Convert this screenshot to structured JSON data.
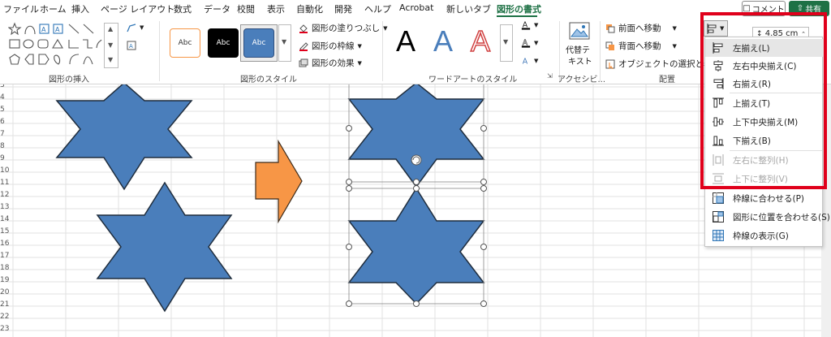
{
  "tabs": [
    "ファイル",
    "ホーム",
    "挿入",
    "ページ レイアウト",
    "数式",
    "データ",
    "校閲",
    "表示",
    "自動化",
    "開発",
    "ヘルプ",
    "Acrobat",
    "新しいタブ",
    "図形の書式"
  ],
  "active_tab": "図形の書式",
  "header_buttons": {
    "comment": "コメント",
    "share": "共有"
  },
  "ribbon": {
    "groups": {
      "insert_shapes": "図形の挿入",
      "shape_styles": "図形のスタイル",
      "wordart_styles": "ワードアートのスタイル",
      "accessibility": "アクセシビ...",
      "arrange": "配置"
    },
    "style_samples": [
      "Abc",
      "Abc",
      "Abc"
    ],
    "shape_fill": "図形の塗りつぶし",
    "shape_outline": "図形の枠線",
    "shape_effects": "図形の効果",
    "wordart_letters": [
      "A",
      "A",
      "A"
    ],
    "alt_text_line1": "代替テ",
    "alt_text_line2": "キスト",
    "bring_forward": "前面へ移動",
    "send_backward": "背面へ移動",
    "selection_pane": "オブジェクトの選択と表示",
    "height_value": "4.85 cm"
  },
  "row_numbers": [
    "3",
    "4",
    "5",
    "6",
    "7",
    "8",
    "9",
    "10",
    "11",
    "12",
    "13",
    "14",
    "15",
    "16",
    "17",
    "18",
    "19",
    "20",
    "21",
    "22",
    "23"
  ],
  "align_menu": {
    "items": [
      {
        "label": "左揃え(L)",
        "icon": "align-left-icon",
        "enabled": true
      },
      {
        "label": "左右中央揃え(C)",
        "icon": "align-center-icon",
        "enabled": true
      },
      {
        "label": "右揃え(R)",
        "icon": "align-right-icon",
        "enabled": true
      },
      {
        "label": "上揃え(T)",
        "icon": "align-top-icon",
        "enabled": true
      },
      {
        "label": "上下中央揃え(M)",
        "icon": "align-middle-icon",
        "enabled": true
      },
      {
        "label": "下揃え(B)",
        "icon": "align-bottom-icon",
        "enabled": true
      },
      {
        "label": "左右に整列(H)",
        "icon": "distribute-horizontal-icon",
        "enabled": false
      },
      {
        "label": "上下に整列(V)",
        "icon": "distribute-vertical-icon",
        "enabled": false
      },
      {
        "label": "枠線に合わせる(P)",
        "icon": "snap-to-grid-icon",
        "enabled": true
      },
      {
        "label": "図形に位置を合わせる(S)",
        "icon": "snap-to-shape-icon",
        "enabled": true
      },
      {
        "label": "枠線の表示(G)",
        "icon": "view-gridlines-icon",
        "enabled": true
      }
    ]
  },
  "colors": {
    "accent_green": "#1e7145",
    "star_fill": "#4a7ebb",
    "arrow_fill": "#f79646",
    "highlight_red": "#e0001b"
  }
}
